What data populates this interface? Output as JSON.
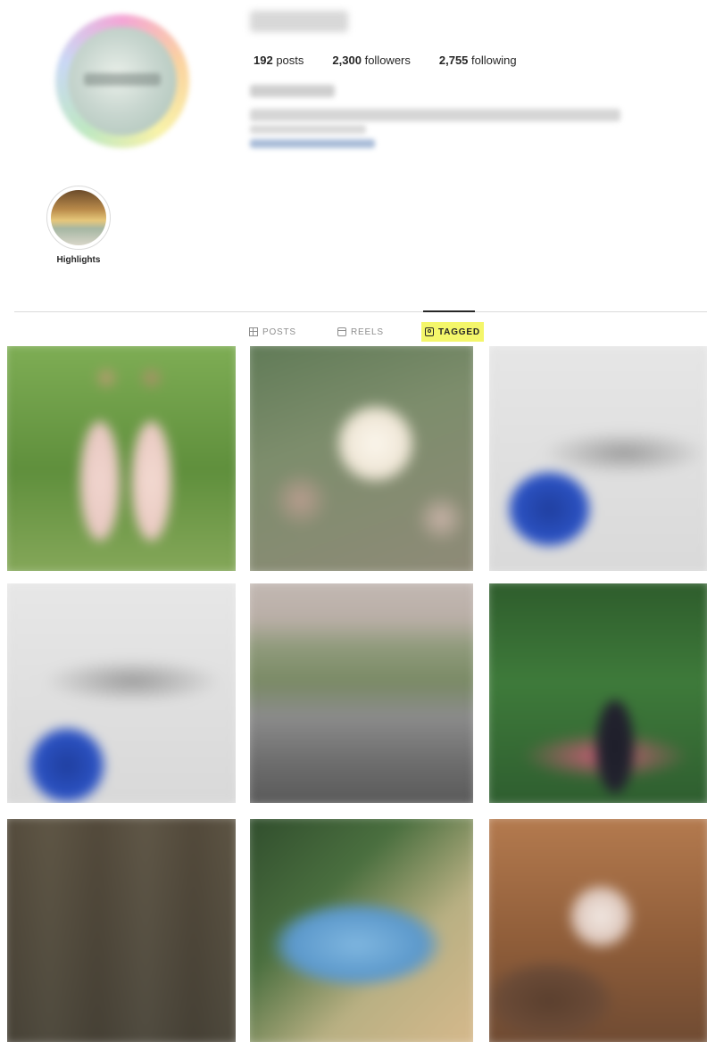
{
  "profile": {
    "stats": {
      "posts": {
        "value": "192",
        "label": "posts"
      },
      "followers": {
        "value": "2,300",
        "label": "followers"
      },
      "following": {
        "value": "2,755",
        "label": "following"
      }
    },
    "highlight": {
      "label": "Highlights"
    }
  },
  "tabs": [
    {
      "label": "POSTS",
      "icon": "grid-icon",
      "active": false
    },
    {
      "label": "REELS",
      "icon": "reels-icon",
      "active": false
    },
    {
      "label": "TAGGED",
      "icon": "tag-icon",
      "active": true,
      "highlight_color": "#f4f66a"
    }
  ],
  "grid": {
    "columns": 3,
    "rows": 3,
    "items": [
      {
        "subject": "bridesmaids"
      },
      {
        "subject": "flowers"
      },
      {
        "subject": "scissors-blue-keychain"
      },
      {
        "subject": "scissors-blue-keychain"
      },
      {
        "subject": "outdoor-court"
      },
      {
        "subject": "person-in-garden"
      },
      {
        "subject": "framed-photos"
      },
      {
        "subject": "blue-sky-sign"
      },
      {
        "subject": "dog"
      }
    ]
  },
  "colors": {
    "text": "#262626",
    "muted": "#8e8e8e",
    "divider": "#dbdbdb",
    "tagged_highlight": "#f4f66a"
  }
}
